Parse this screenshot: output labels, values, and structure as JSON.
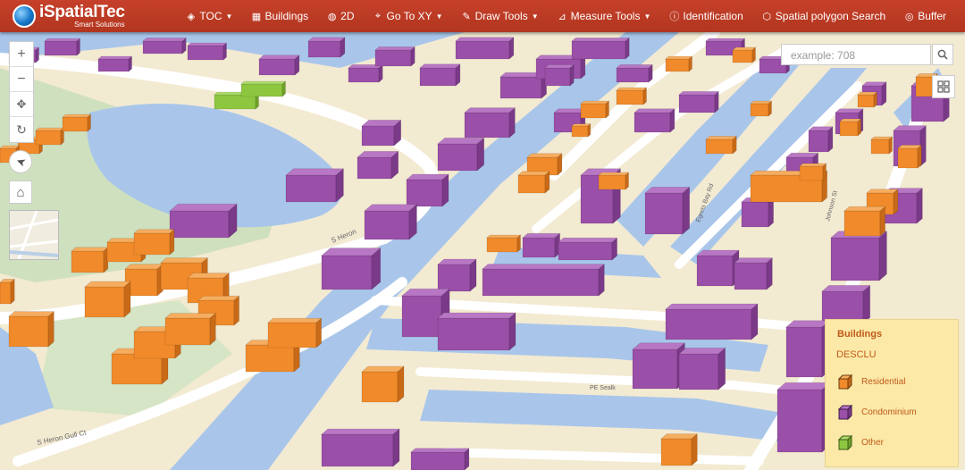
{
  "app": {
    "logo_name": "iSpatialTec",
    "logo_tagline": "Smart Solutions"
  },
  "nav": {
    "items": [
      {
        "label": "TOC",
        "icon": "layers-icon",
        "dropdown": true
      },
      {
        "label": "Buildings",
        "icon": "table-icon",
        "dropdown": false
      },
      {
        "label": "2D",
        "icon": "globe-icon",
        "dropdown": false
      },
      {
        "label": "Go To XY",
        "icon": "marker-icon",
        "dropdown": true
      },
      {
        "label": "Draw Tools",
        "icon": "pen-icon",
        "dropdown": true
      },
      {
        "label": "Measure Tools",
        "icon": "chart-icon",
        "dropdown": true
      },
      {
        "label": "Identification",
        "icon": "info-icon",
        "dropdown": false
      },
      {
        "label": "Spatial polygon Search",
        "icon": "polygon-icon",
        "dropdown": false
      },
      {
        "label": "Buffer",
        "icon": "buffer-icon",
        "dropdown": false
      }
    ]
  },
  "search": {
    "placeholder": "example: 708",
    "value": ""
  },
  "controls": {
    "zoom_in": "+",
    "zoom_out": "−",
    "pan": "✥",
    "rotate": "↻",
    "compass": "➤",
    "home": "⌂"
  },
  "map_labels": {
    "street_1": "S Heron",
    "street_2": "S Heron Gull Ct",
    "street_3": "PE Sealk",
    "street_4": "Egrets Bay Rd",
    "street_5": "Johnson St"
  },
  "legend": {
    "title": "Buildings",
    "field": "DESCLU",
    "items": [
      {
        "label": "Residential",
        "color": "#f08a2a"
      },
      {
        "label": "Condominium",
        "color": "#9a4fa8"
      },
      {
        "label": "Other",
        "color": "#8dc63f"
      }
    ]
  },
  "colors": {
    "header": "#b73a22",
    "water": "#a9c6ea",
    "land": "#f3ead2",
    "residential": "#f08a2a",
    "condominium": "#9a4fa8",
    "other": "#8dc63f"
  }
}
